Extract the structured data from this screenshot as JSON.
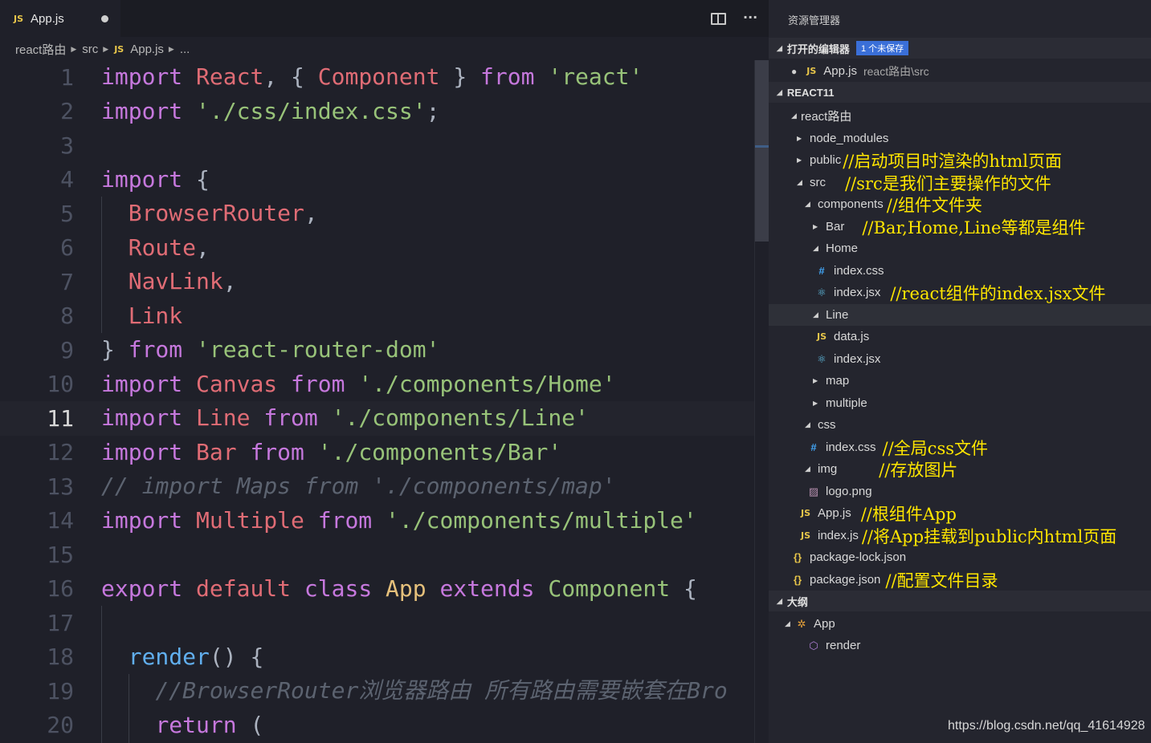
{
  "editor": {
    "tab": {
      "badge": "JS",
      "label": "App.js"
    },
    "more_label": "···",
    "breadcrumb": {
      "part1": "react路由",
      "part2": "src",
      "badge": "JS",
      "part3": "App.js",
      "part4": "..."
    }
  },
  "code": {
    "ln": [
      "1",
      "2",
      "3",
      "4",
      "5",
      "6",
      "7",
      "8",
      "9",
      "10",
      "11",
      "12",
      "13",
      "14",
      "15",
      "16",
      "17",
      "18",
      "19",
      "20"
    ],
    "l1": [
      "import",
      "React",
      ",",
      "{",
      "Component",
      "}",
      "from",
      "'react'"
    ],
    "l2": [
      "import",
      "'./css/index.css'",
      ";"
    ],
    "l4": [
      "import",
      "{"
    ],
    "l5": [
      "BrowserRouter",
      ","
    ],
    "l6": [
      "Route",
      ","
    ],
    "l7": [
      "NavLink",
      ","
    ],
    "l8": [
      "Link"
    ],
    "l9": [
      "}",
      "from",
      "'react-router-dom'"
    ],
    "l10": [
      "import",
      "Canvas",
      "from",
      "'./components/Home'"
    ],
    "l11": [
      "import",
      "Line",
      "from",
      "'./components/Line'"
    ],
    "l12": [
      "import",
      "Bar",
      "from",
      "'./components/Bar'"
    ],
    "l13": "// import Maps from './components/map'",
    "l14": [
      "import",
      "Multiple",
      "from",
      "'./components/multiple'"
    ],
    "l16": [
      "export",
      "default",
      "class",
      "App",
      "extends",
      "Component",
      "{"
    ],
    "l18": [
      "render",
      "()",
      "{"
    ],
    "l19": "//BrowserRouter浏览器路由 所有路由需要嵌套在Bro",
    "l20": [
      "return",
      "("
    ]
  },
  "sidebar": {
    "title": "资源管理器",
    "open_editors": {
      "label": "打开的编辑器",
      "badge": "1 个未保存"
    },
    "open_file": {
      "badge": "JS",
      "name": "App.js",
      "path": "react路由\\src"
    },
    "project": {
      "label": "REACT11"
    },
    "tree": {
      "root": "react路由",
      "node_modules": "node_modules",
      "public": "public",
      "public_note": "//启动项目时渲染的html页面",
      "src": "src",
      "src_note": "//src是我们主要操作的文件",
      "components": "components",
      "components_note": "//组件文件夹",
      "bar": "Bar",
      "bar_note": "//Bar,Home,Line等都是组件",
      "home": "Home",
      "home_css": "index.css",
      "home_jsx": "index.jsx",
      "home_jsx_note": "//react组件的index.jsx文件",
      "line": "Line",
      "line_data": "data.js",
      "line_jsx": "index.jsx",
      "map": "map",
      "multiple": "multiple",
      "css": "css",
      "css_index": "index.css",
      "css_index_note": "//全局css文件",
      "img": "img",
      "img_note": "//存放图片",
      "logo": "logo.png",
      "app_js": "App.js",
      "app_js_note": "//根组件App",
      "index_js": "index.js",
      "index_js_note": "//将App挂载到public内html页面",
      "package_lock": "package-lock.json",
      "package_json": "package.json",
      "package_json_note": "//配置文件目录"
    },
    "outline": {
      "label": "大纲",
      "app": "App",
      "render": "render"
    }
  },
  "watermark": "https://blog.csdn.net/qq_41614928",
  "colors": {
    "keyword": "#c678dd",
    "identifier": "#e06c75",
    "string": "#98c379",
    "annotation": "#ffe600",
    "badge": "#3a6fd8"
  }
}
